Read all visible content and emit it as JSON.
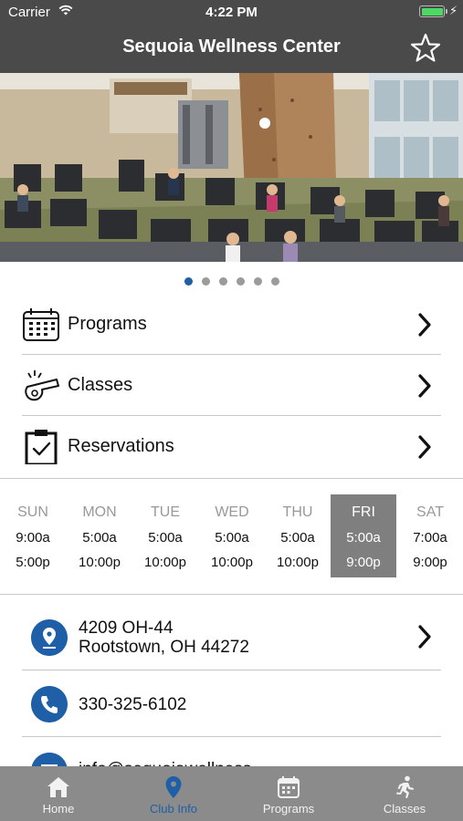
{
  "status_bar": {
    "carrier": "Carrier",
    "time": "4:22 PM"
  },
  "nav": {
    "title": "Sequoia Wellness Center"
  },
  "carousel": {
    "page_count": 6,
    "active_index": 0
  },
  "menu": [
    {
      "label": "Programs",
      "icon": "calendar-icon"
    },
    {
      "label": "Classes",
      "icon": "whistle-icon"
    },
    {
      "label": "Reservations",
      "icon": "clipboard-check-icon"
    }
  ],
  "hours": [
    {
      "day": "SUN",
      "open": "9:00a",
      "close": "5:00p"
    },
    {
      "day": "MON",
      "open": "5:00a",
      "close": "10:00p"
    },
    {
      "day": "TUE",
      "open": "5:00a",
      "close": "10:00p"
    },
    {
      "day": "WED",
      "open": "5:00a",
      "close": "10:00p"
    },
    {
      "day": "THU",
      "open": "5:00a",
      "close": "10:00p"
    },
    {
      "day": "FRI",
      "open": "5:00a",
      "close": "9:00p",
      "today": true
    },
    {
      "day": "SAT",
      "open": "7:00a",
      "close": "9:00p"
    }
  ],
  "contact": {
    "address_line1": "4209 OH-44",
    "address_line2": "Rootstown, OH 44272",
    "phone": "330-325-6102",
    "email_partial": "info@sequoiawellness"
  },
  "tabs": [
    {
      "label": "Home",
      "icon": "home-icon"
    },
    {
      "label": "Club Info",
      "icon": "location-pin-icon",
      "active": true
    },
    {
      "label": "Programs",
      "icon": "calendar-icon"
    },
    {
      "label": "Classes",
      "icon": "running-person-icon"
    }
  ],
  "colors": {
    "header": "#4a4a4a",
    "accent": "#1f5fa8",
    "tabbar": "#8b8b8b",
    "today": "#7f7f7f"
  }
}
